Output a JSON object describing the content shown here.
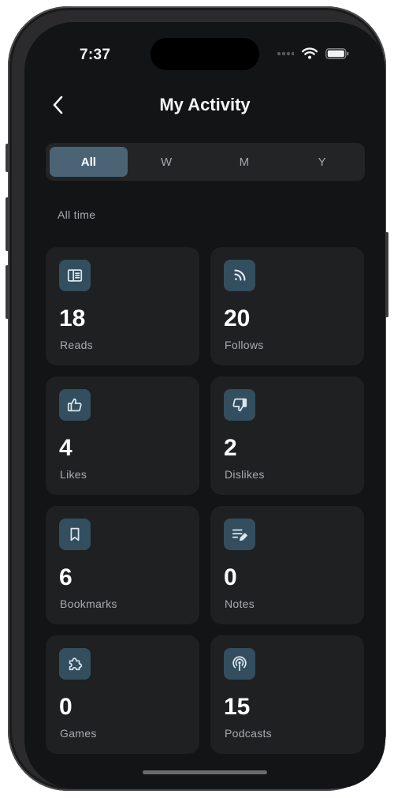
{
  "status_bar": {
    "time": "7:37"
  },
  "nav": {
    "title": "My Activity"
  },
  "segments": {
    "selected": "All",
    "items": [
      "All",
      "W",
      "M",
      "Y"
    ]
  },
  "period_label": "All time",
  "stats": [
    {
      "count": "18",
      "label": "Reads",
      "icon": "reader-icon"
    },
    {
      "count": "20",
      "label": "Follows",
      "icon": "rss-icon"
    },
    {
      "count": "4",
      "label": "Likes",
      "icon": "thumbs-up-icon"
    },
    {
      "count": "2",
      "label": "Dislikes",
      "icon": "thumbs-down-icon"
    },
    {
      "count": "6",
      "label": "Bookmarks",
      "icon": "bookmark-icon"
    },
    {
      "count": "0",
      "label": "Notes",
      "icon": "note-edit-icon"
    },
    {
      "count": "0",
      "label": "Games",
      "icon": "puzzle-icon"
    },
    {
      "count": "15",
      "label": "Podcasts",
      "icon": "podcast-icon"
    }
  ],
  "colors": {
    "background": "#131416",
    "card": "#1e2022",
    "icon_tile": "#334e5e",
    "icon_stroke": "#dbe7ee",
    "segment_active": "#4a6476"
  }
}
